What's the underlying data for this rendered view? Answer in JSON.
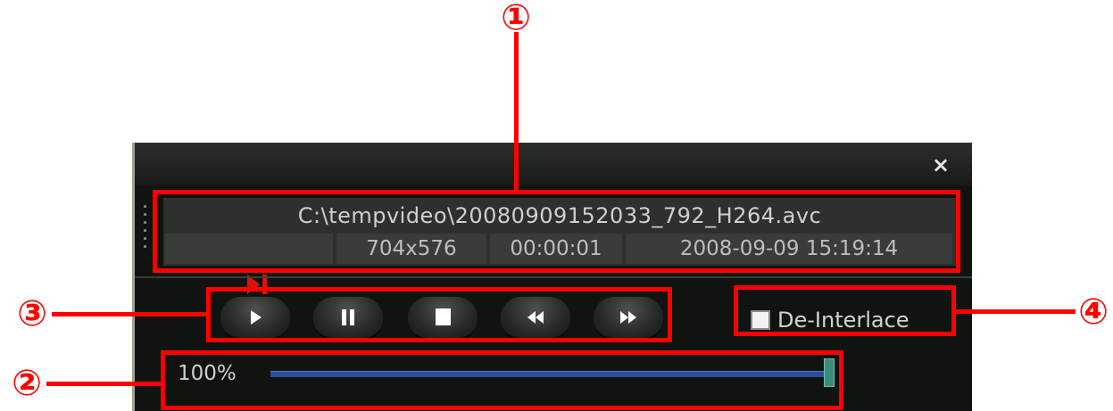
{
  "player": {
    "close_label": "×",
    "file_path": "C:\\tempvideo\\20080909152033_792_H264.avc",
    "resolution": "704x576",
    "time_position": "00:00:01",
    "datetime": "2008-09-09 15:19:14",
    "deinterlace_label": "De-Interlace",
    "deinterlace_checked": false,
    "zoom_label": "100%",
    "zoom_level_percent": 100,
    "playback_buttons": [
      "play-icon",
      "pause-icon",
      "stop-icon",
      "rewind-icon",
      "fast-forward-icon"
    ]
  },
  "callouts": {
    "n1": "①",
    "n2": "②",
    "n3": "③",
    "n4": "④"
  },
  "colors": {
    "callout": "#ff0000",
    "indicator": "#e01010",
    "slider": "#2a4d9a",
    "handle": "#3b8c7c"
  }
}
